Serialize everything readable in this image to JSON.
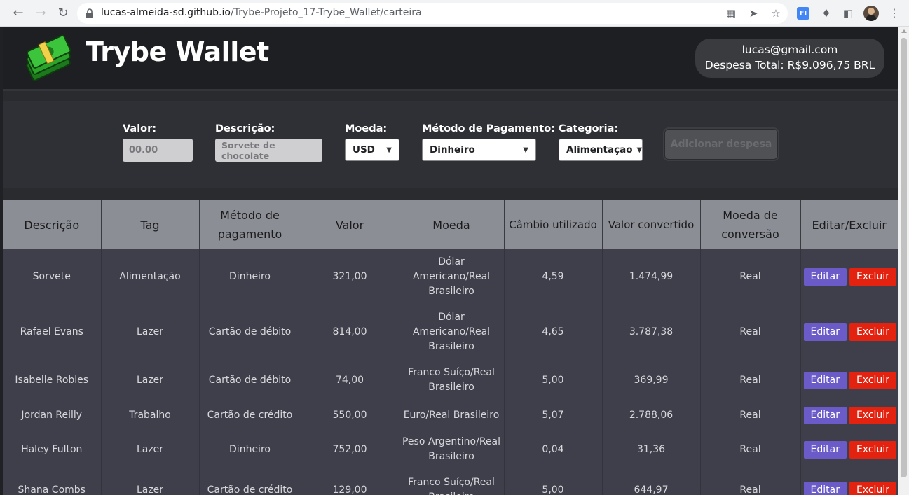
{
  "browser": {
    "url_host": "lucas-almeida-sd.github.io",
    "url_path": "/Trybe-Projeto_17-Trybe_Wallet/carteira"
  },
  "header": {
    "title": "Trybe Wallet",
    "email": "lucas@gmail.com",
    "total_label": "Despesa Total: R$9.096,75 BRL"
  },
  "form": {
    "valor_label": "Valor:",
    "valor_placeholder": "00.00",
    "descricao_label": "Descrição:",
    "descricao_placeholder": "Sorvete de chocolate",
    "moeda_label": "Moeda:",
    "moeda_value": "USD",
    "metodo_label": "Método de Pagamento:",
    "metodo_value": "Dinheiro",
    "categoria_label": "Categoria:",
    "categoria_value": "Alimentação",
    "add_button": "Adicionar despesa"
  },
  "table": {
    "headers": [
      "Descrição",
      "Tag",
      "Método de pagamento",
      "Valor",
      "Moeda",
      "Câmbio utilizado",
      "Valor convertido",
      "Moeda de conversão",
      "Editar/Excluir"
    ],
    "edit_label": "Editar",
    "delete_label": "Excluir",
    "rows": [
      {
        "descricao": "Sorvete",
        "tag": "Alimentação",
        "metodo": "Dinheiro",
        "valor": "321,00",
        "moeda": "Dólar Americano/Real Brasileiro",
        "cambio": "4,59",
        "convertido": "1.474,99",
        "conversao": "Real"
      },
      {
        "descricao": "Rafael Evans",
        "tag": "Lazer",
        "metodo": "Cartão de débito",
        "valor": "814,00",
        "moeda": "Dólar Americano/Real Brasileiro",
        "cambio": "4,65",
        "convertido": "3.787,38",
        "conversao": "Real"
      },
      {
        "descricao": "Isabelle Robles",
        "tag": "Lazer",
        "metodo": "Cartão de débito",
        "valor": "74,00",
        "moeda": "Franco Suíço/Real Brasileiro",
        "cambio": "5,00",
        "convertido": "369,99",
        "conversao": "Real"
      },
      {
        "descricao": "Jordan Reilly",
        "tag": "Trabalho",
        "metodo": "Cartão de crédito",
        "valor": "550,00",
        "moeda": "Euro/Real Brasileiro",
        "cambio": "5,07",
        "convertido": "2.788,06",
        "conversao": "Real"
      },
      {
        "descricao": "Haley Fulton",
        "tag": "Lazer",
        "metodo": "Dinheiro",
        "valor": "752,00",
        "moeda": "Peso Argentino/Real Brasileiro",
        "cambio": "0,04",
        "convertido": "31,36",
        "conversao": "Real"
      },
      {
        "descricao": "Shana Combs",
        "tag": "Lazer",
        "metodo": "Cartão de crédito",
        "valor": "129,00",
        "moeda": "Franco Suíço/Real Brasileiro",
        "cambio": "5,00",
        "convertido": "644,97",
        "conversao": "Real"
      }
    ]
  },
  "colors": {
    "edit_button": "#6b5bc8",
    "delete_button": "#e3220f",
    "header_row": "#8c8e95",
    "body_row": "#3e3f4a"
  }
}
